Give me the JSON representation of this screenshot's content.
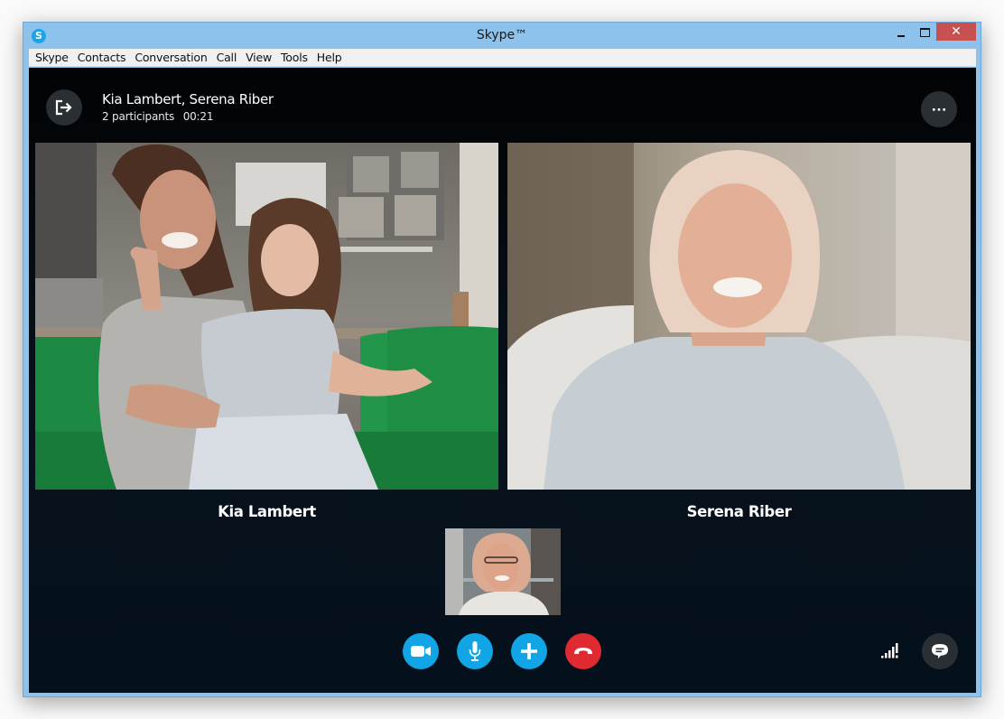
{
  "window": {
    "title": "Skype™",
    "app_icon_letter": "S",
    "controls": {
      "minimize": "minimize",
      "maximize": "maximize",
      "close": "✕"
    }
  },
  "menubar": {
    "items": [
      "Skype",
      "Contacts",
      "Conversation",
      "Call",
      "View",
      "Tools",
      "Help"
    ]
  },
  "call": {
    "title": "Kia Lambert, Serena Riber",
    "participants_label": "2 participants",
    "duration": "00:21",
    "leave_icon": "leave-call-icon",
    "more_icon": "more-options-icon"
  },
  "participants": [
    {
      "name": "Kia Lambert",
      "video": "woman-and-child-waving-on-green-sofa"
    },
    {
      "name": "Serena Riber",
      "video": "smiling-older-woman-in-armchair"
    }
  ],
  "self_view": {
    "video": "older-woman-with-glasses-self-preview"
  },
  "controls": [
    {
      "name": "video",
      "icon": "video-camera-icon",
      "color": "#12a5e6"
    },
    {
      "name": "microphone",
      "icon": "microphone-icon",
      "color": "#12a5e6"
    },
    {
      "name": "add",
      "icon": "plus-icon",
      "color": "#12a5e6"
    },
    {
      "name": "hang-up",
      "icon": "hang-up-icon",
      "color": "#e02a31"
    }
  ],
  "status": {
    "signal_icon": "signal-strength-icon",
    "chat_icon": "chat-bubble-icon"
  },
  "colors": {
    "accent": "#12a5e6",
    "hangup": "#e02a31",
    "window_frame": "#8cc2eb",
    "close_button": "#c75050",
    "call_background": "#04101b"
  }
}
